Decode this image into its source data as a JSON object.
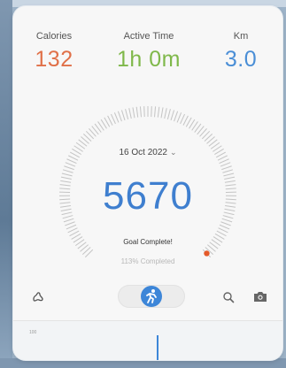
{
  "stats": {
    "calories": {
      "label": "Calories",
      "value": "132"
    },
    "active_time": {
      "label": "Active Time",
      "value": "1h 0m"
    },
    "distance": {
      "label": "Km",
      "value": "3.0"
    }
  },
  "gauge": {
    "date": "16 Oct 2022",
    "steps": "5670",
    "goal_text": "Goal Complete!",
    "percent_text": "113% Completed",
    "progress_fraction": 1.13
  },
  "chart": {
    "axis_label": "100"
  },
  "colors": {
    "calories": "#e07048",
    "active_time": "#7fb84a",
    "distance": "#4a8ed6",
    "accent": "#3d86d8"
  },
  "icons": [
    "shoe-icon",
    "runner-icon",
    "search-icon",
    "camera-icon",
    "chevron-down-icon"
  ]
}
